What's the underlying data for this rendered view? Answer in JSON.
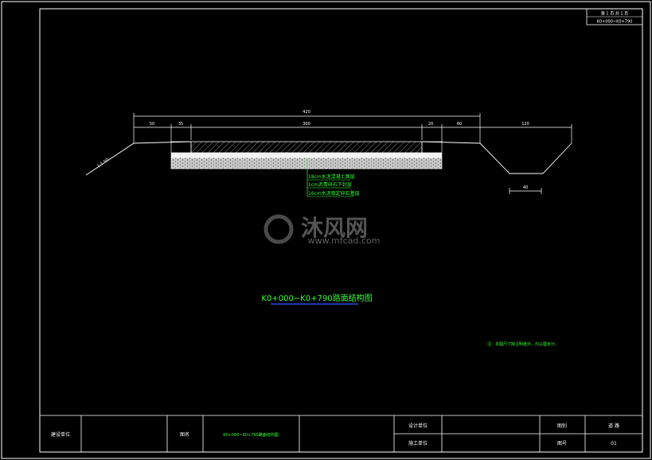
{
  "sheet": {
    "page_label": "第 1 页  共 1 页",
    "page_code": "K0+000~K0+790"
  },
  "section": {
    "dim_total": "420",
    "dim_left_1": "50",
    "dim_left_2": "35",
    "dim_center": "300",
    "dim_right_1": "20",
    "dim_right_2": "60",
    "dim_right_3": "120",
    "dim_ditch": "40",
    "slope_label": "1:1.50",
    "layers": [
      "18cm水泥混凝土面层",
      "1cm沥青碎石下封层",
      "16cm水泥稳定碎石基层"
    ],
    "title": "K0+000~K0+790路面结构图",
    "note": "注：本图尺寸除注明者外，均以厘米计。"
  },
  "titleblock": {
    "construction_unit_label": "建设单位",
    "drawing_name_label": "图名",
    "drawing_name": "K0+000~K0+790路面结构图",
    "design_unit_label": "设计单位",
    "build_unit_label": "施工单位",
    "category_label": "图别",
    "category_value": "道  路",
    "number_label": "图号",
    "number_value": "01"
  },
  "colors": {
    "background": "#000000",
    "line": "#ffffff",
    "text_green": "#33ff33",
    "text_yellow": "#ffff66",
    "title_blue": "#3355ff"
  },
  "watermark": {
    "brand": "沐风网",
    "url": "www.mfcad.com"
  }
}
